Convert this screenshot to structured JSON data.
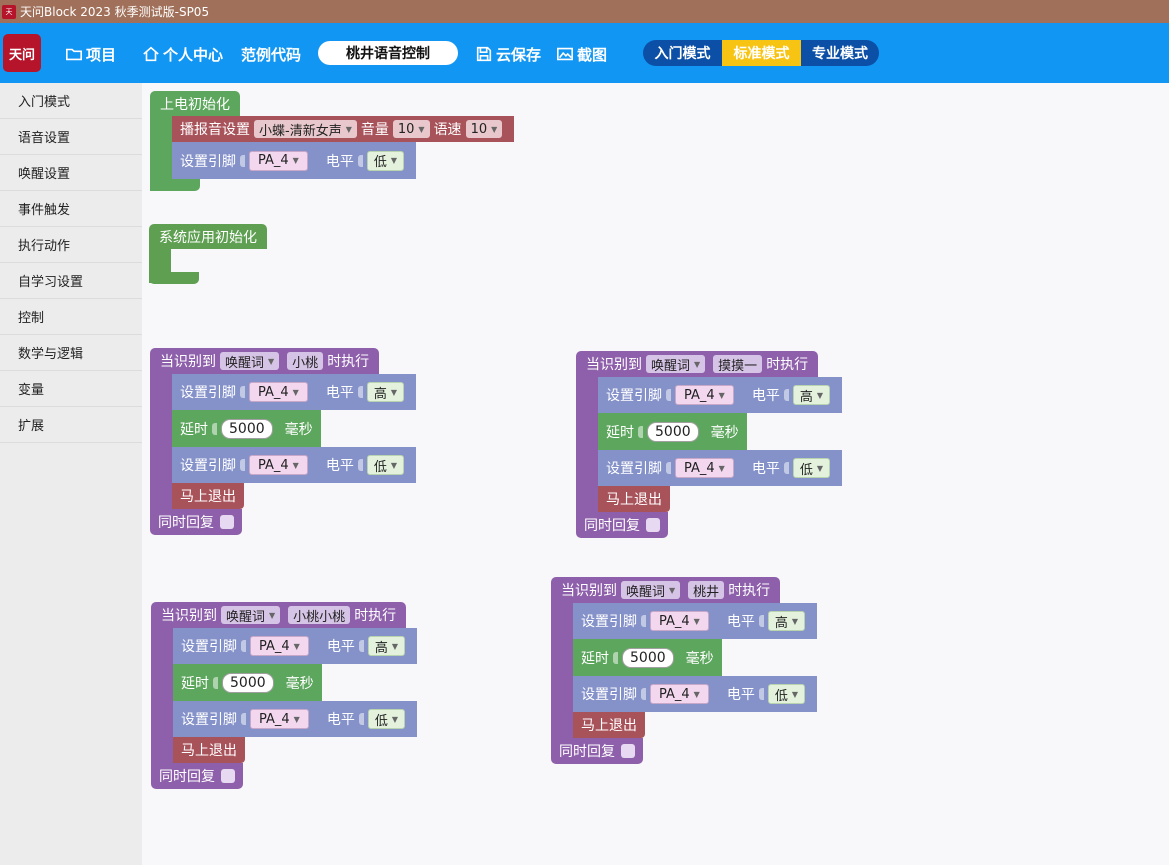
{
  "window": {
    "title": "天问Block 2023 秋季测试版-SP05"
  },
  "toolbar": {
    "logo": "天问",
    "project_label": "项目",
    "user_center_label": "个人中心",
    "example_code_label": "范例代码",
    "project_name": "桃井语音控制",
    "cloud_save_label": "云保存",
    "screenshot_label": "截图",
    "modes": [
      "入门模式",
      "标准模式",
      "专业模式"
    ],
    "active_mode": "标准模式"
  },
  "sidebar": {
    "items": [
      {
        "label": "入门模式"
      },
      {
        "label": "语音设置"
      },
      {
        "label": "唤醒设置"
      },
      {
        "label": "事件触发"
      },
      {
        "label": "执行动作"
      },
      {
        "label": "自学习设置"
      },
      {
        "label": "控制"
      },
      {
        "label": "数学与逻辑"
      },
      {
        "label": "变量"
      },
      {
        "label": "扩展"
      }
    ]
  },
  "blocks": {
    "init": {
      "hat": "上电初始化",
      "voice_setting_label": "播报音设置",
      "voice_value": "小蝶-清新女声",
      "volume_label": "音量",
      "volume_value": "10",
      "speed_label": "语速",
      "speed_value": "10",
      "set_pin_label": "设置引脚",
      "pin_value": "PA_4",
      "level_label": "电平",
      "level_value": "低"
    },
    "sys_init": {
      "hat": "系统应用初始化"
    },
    "common": {
      "when_recognized": "当识别到",
      "wake_word": "唤醒词",
      "then_execute": "时执行",
      "set_pin": "设置引脚",
      "pin": "PA_4",
      "level": "电平",
      "high": "高",
      "low": "低",
      "delay": "延时",
      "delay_value": "5000",
      "ms": "毫秒",
      "exit": "马上退出",
      "reply": "同时回复"
    },
    "events": [
      {
        "keyword": "小桃"
      },
      {
        "keyword": "摸摸一"
      },
      {
        "keyword": "小桃小桃"
      },
      {
        "keyword": "桃井"
      }
    ]
  }
}
